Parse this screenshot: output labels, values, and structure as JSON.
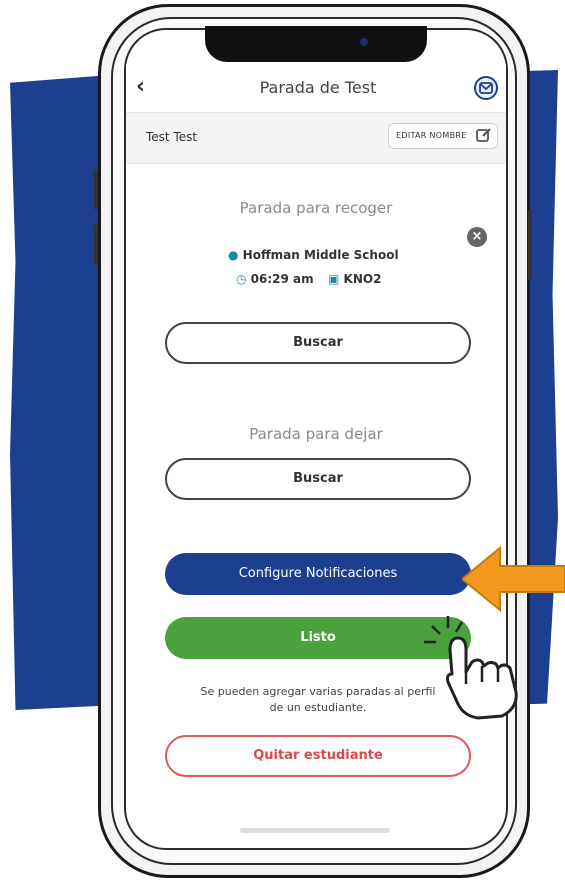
{
  "header": {
    "title": "Parada de Test",
    "back_icon": "chevron-left-icon",
    "mail_icon": "envelope-icon"
  },
  "student": {
    "name": "Test Test",
    "edit_label": "EDITAR NOMBRE",
    "edit_icon": "edit-icon"
  },
  "pickup": {
    "title": "Parada para recoger",
    "school": "Hoffman Middle School",
    "time": "06:29 am",
    "bus": "KNO2",
    "search_label": "Buscar"
  },
  "dropoff": {
    "title": "Parada para dejar",
    "search_label": "Buscar"
  },
  "actions": {
    "notifications_label": "Configure Notificaciones",
    "done_label": "Listo",
    "helper_text_1": "Se pueden agregar varias paradas al perfil",
    "helper_text_2": "de un estudiante.",
    "remove_label": "Quitar estudiante"
  },
  "colors": {
    "primary": "#1d3f8f",
    "success": "#4aa23c",
    "danger": "#d94b4b",
    "accent": "#f39a1e",
    "teal": "#1a8aa0"
  }
}
